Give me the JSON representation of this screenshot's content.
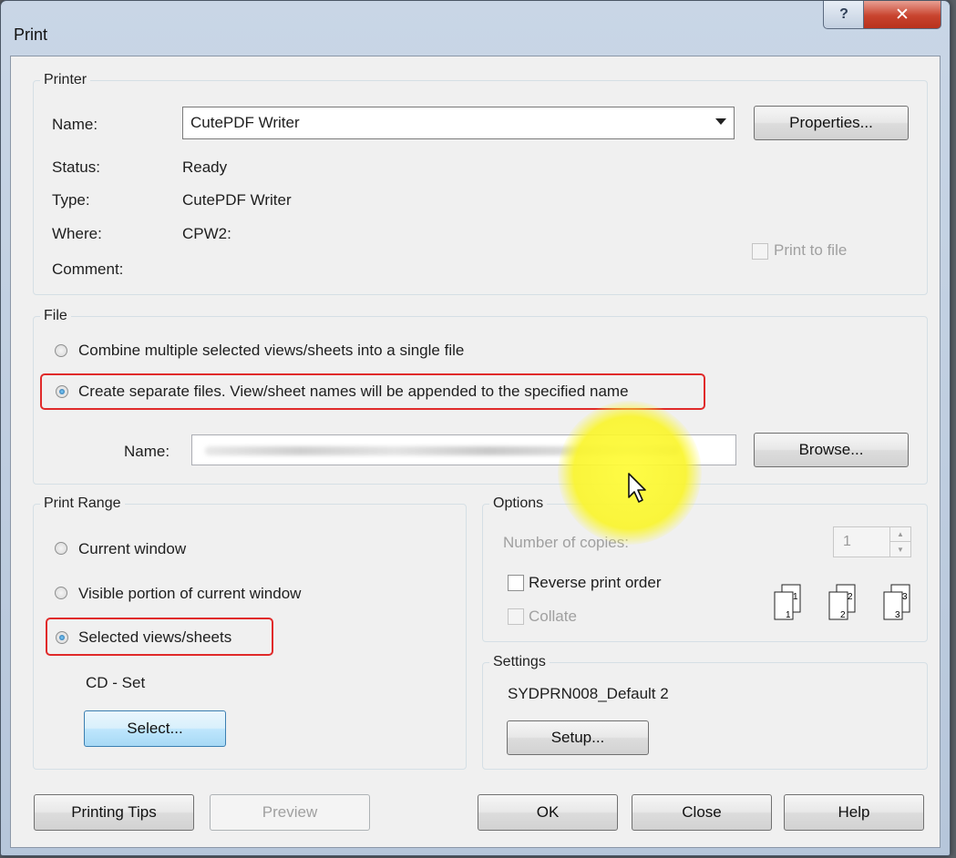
{
  "window": {
    "title": "Print",
    "help_glyph": "?",
    "close_glyph": "✕"
  },
  "printer": {
    "group_label": "Printer",
    "name_label": "Name:",
    "name_value": "CutePDF Writer",
    "properties_button": "Properties...",
    "status_label": "Status:",
    "status_value": "Ready",
    "type_label": "Type:",
    "type_value": "CutePDF Writer",
    "where_label": "Where:",
    "where_value": "CPW2:",
    "comment_label": "Comment:",
    "print_to_file_label": "Print to file"
  },
  "file": {
    "group_label": "File",
    "combine_label": "Combine multiple selected views/sheets into a single file",
    "separate_label": "Create separate files. View/sheet names will be appended to the specified name",
    "name_label": "Name:",
    "browse_button": "Browse..."
  },
  "print_range": {
    "group_label": "Print Range",
    "current_window_label": "Current window",
    "visible_portion_label": "Visible portion of current window",
    "selected_label": "Selected views/sheets",
    "set_name": "CD - Set",
    "select_button": "Select..."
  },
  "options": {
    "group_label": "Options",
    "copies_label": "Number of copies:",
    "copies_value": "1",
    "reverse_label": "Reverse print order",
    "collate_label": "Collate",
    "page_numbers": [
      "1",
      "2",
      "3"
    ]
  },
  "settings": {
    "group_label": "Settings",
    "value": "SYDPRN008_Default 2",
    "setup_button": "Setup..."
  },
  "footer": {
    "printing_tips_button": "Printing Tips",
    "preview_button": "Preview",
    "ok_button": "OK",
    "close_button": "Close",
    "help_button": "Help"
  },
  "colors": {
    "highlight_box": "#e02a2a",
    "cursor_spotlight": "#fff83a"
  }
}
